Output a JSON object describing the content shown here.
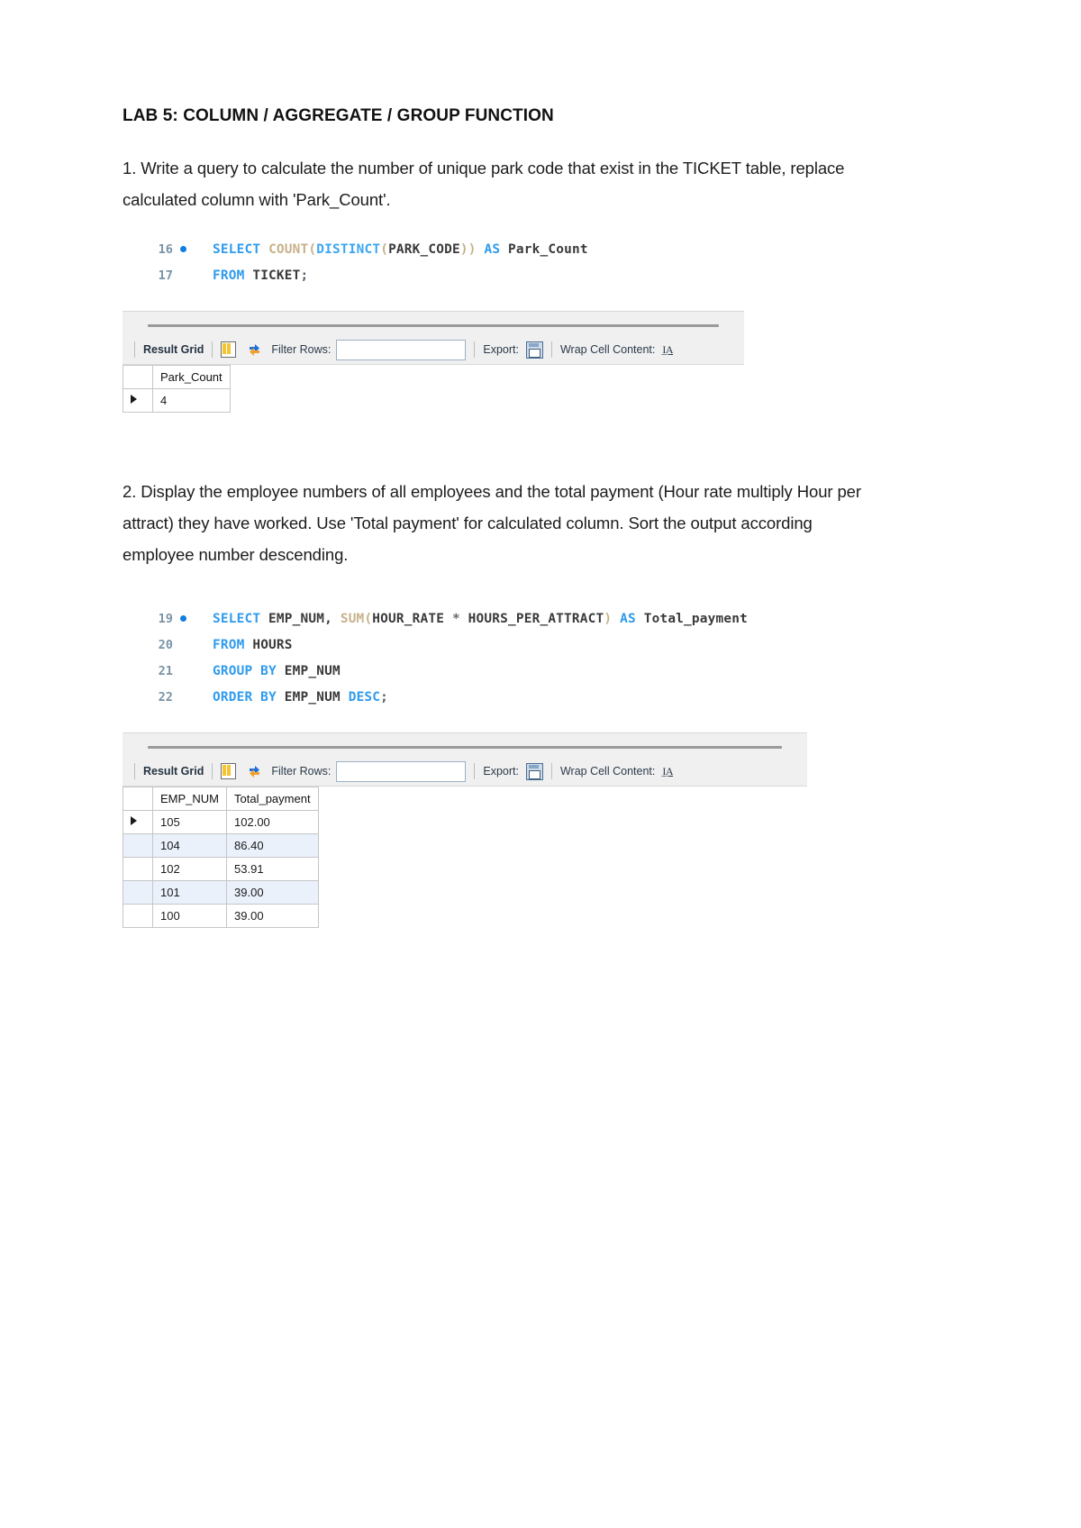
{
  "document": {
    "title": "LAB 5: COLUMN / AGGREGATE / GROUP FUNCTION"
  },
  "questions": [
    {
      "text": "1. Write a query to calculate the number of unique park code that exist in the TICKET table, replace calculated column with 'Park_Count'.",
      "code": {
        "lines": [
          {
            "number": "16",
            "has_breakpoint_dot": true,
            "tokens": [
              {
                "t": "SELECT",
                "c": "kw"
              },
              {
                "t": " ",
                "c": "id"
              },
              {
                "t": "COUNT",
                "c": "fn"
              },
              {
                "t": "(",
                "c": "fn"
              },
              {
                "t": "DISTINCT",
                "c": "kw2"
              },
              {
                "t": "(",
                "c": "fn"
              },
              {
                "t": "PARK_CODE",
                "c": "id"
              },
              {
                "t": "))",
                "c": "fn"
              },
              {
                "t": " ",
                "c": "id"
              },
              {
                "t": "AS",
                "c": "kw"
              },
              {
                "t": " Park_Count",
                "c": "id"
              }
            ]
          },
          {
            "number": "17",
            "has_breakpoint_dot": false,
            "tokens": [
              {
                "t": "FROM",
                "c": "kw"
              },
              {
                "t": " TICKET",
                "c": "id"
              },
              {
                "t": ";",
                "c": "punc"
              }
            ]
          }
        ]
      },
      "result": {
        "toolbar": {
          "result_grid_label": "Result Grid",
          "grid_icon": "grid-view-icon",
          "refresh_icon": "refresh-icon",
          "filter_rows_label": "Filter Rows:",
          "filter_value": "",
          "filter_placeholder": "",
          "export_label": "Export:",
          "export_icon": "export-save-icon",
          "wrap_cell_label": "Wrap Cell Content:",
          "wrap_cell_icon": "wrap-text-icon"
        },
        "columns": [
          "Park_Count"
        ],
        "rows": [
          {
            "selected": true,
            "cells": [
              "4"
            ]
          }
        ]
      }
    },
    {
      "text": "2. Display the employee numbers of all employees and the total payment (Hour rate multiply Hour per attract) they have worked. Use 'Total payment' for calculated column. Sort the output according employee number descending.",
      "code": {
        "lines": [
          {
            "number": "19",
            "has_breakpoint_dot": true,
            "tokens": [
              {
                "t": "SELECT",
                "c": "kw"
              },
              {
                "t": " EMP_NUM, ",
                "c": "id"
              },
              {
                "t": "SUM",
                "c": "fn"
              },
              {
                "t": "(",
                "c": "fn"
              },
              {
                "t": "HOUR_RATE ",
                "c": "id"
              },
              {
                "t": "*",
                "c": "op"
              },
              {
                "t": " HOURS_PER_ATTRACT",
                "c": "id"
              },
              {
                "t": ")",
                "c": "fn"
              },
              {
                "t": " ",
                "c": "id"
              },
              {
                "t": "AS",
                "c": "kw"
              },
              {
                "t": " Total_payment",
                "c": "id"
              }
            ]
          },
          {
            "number": "20",
            "has_breakpoint_dot": false,
            "tokens": [
              {
                "t": "FROM",
                "c": "kw"
              },
              {
                "t": " HOURS",
                "c": "id"
              }
            ]
          },
          {
            "number": "21",
            "has_breakpoint_dot": false,
            "tokens": [
              {
                "t": "GROUP BY",
                "c": "kw"
              },
              {
                "t": " EMP_NUM",
                "c": "id"
              }
            ]
          },
          {
            "number": "22",
            "has_breakpoint_dot": false,
            "tokens": [
              {
                "t": "ORDER BY",
                "c": "kw"
              },
              {
                "t": " EMP_NUM ",
                "c": "id"
              },
              {
                "t": "DESC",
                "c": "kw"
              },
              {
                "t": ";",
                "c": "punc"
              }
            ]
          }
        ]
      },
      "result": {
        "toolbar": {
          "result_grid_label": "Result Grid",
          "grid_icon": "grid-view-icon",
          "refresh_icon": "refresh-icon",
          "filter_rows_label": "Filter Rows:",
          "filter_value": "",
          "filter_placeholder": "",
          "export_label": "Export:",
          "export_icon": "export-save-icon",
          "wrap_cell_label": "Wrap Cell Content:",
          "wrap_cell_icon": "wrap-text-icon"
        },
        "columns": [
          "EMP_NUM",
          "Total_payment"
        ],
        "rows": [
          {
            "selected": true,
            "alt": false,
            "cells": [
              "105",
              "102.00"
            ]
          },
          {
            "selected": false,
            "alt": true,
            "cells": [
              "104",
              "86.40"
            ]
          },
          {
            "selected": false,
            "alt": false,
            "cells": [
              "102",
              "53.91"
            ]
          },
          {
            "selected": false,
            "alt": true,
            "cells": [
              "101",
              "39.00"
            ]
          },
          {
            "selected": false,
            "alt": false,
            "cells": [
              "100",
              "39.00"
            ]
          }
        ]
      }
    }
  ],
  "colors": {
    "keyword": "#2f9bed",
    "function": "#c7b18a",
    "identifier": "#3a3a3a",
    "line_number": "#7a94a8",
    "breakpoint_dot": "#0e7fe1",
    "toolbar_bg": "#f0f0f0",
    "alt_row_bg": "#eaf1fb",
    "grid_border": "#c6c6c6"
  }
}
